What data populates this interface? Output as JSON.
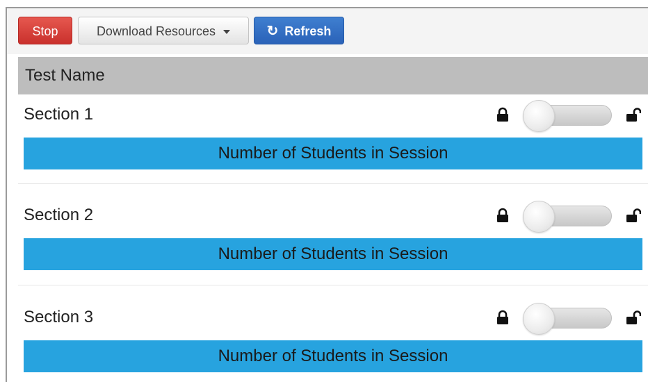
{
  "toolbar": {
    "stop_label": "Stop",
    "download_label": "Download Resources",
    "refresh_label": "Refresh"
  },
  "table": {
    "header": "Test Name"
  },
  "sections": [
    {
      "title": "Section 1",
      "bar_label": "Number of Students in Session"
    },
    {
      "title": "Section 2",
      "bar_label": "Number of Students in Session"
    },
    {
      "title": "Section 3",
      "bar_label": "Number of Students in Session"
    }
  ],
  "colors": {
    "stop": "#d9534f",
    "refresh": "#2f6fc4",
    "session_bar": "#27a3df",
    "header_bg": "#bdbdbd"
  },
  "icons": {
    "lock": "lock-icon",
    "unlock": "unlock-icon",
    "refresh": "refresh-icon",
    "caret": "caret-down-icon"
  }
}
